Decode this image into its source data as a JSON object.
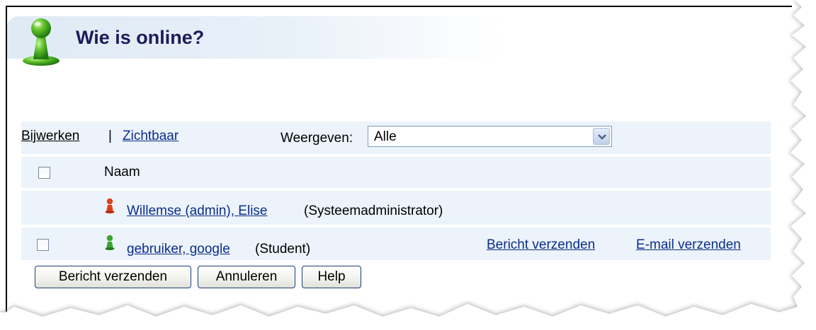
{
  "header": {
    "title": "Wie is online?"
  },
  "toolbar": {
    "refresh_label": "Bijwerken",
    "separator": "|",
    "visible_label": "Zichtbaar",
    "display_label": "Weergeven:",
    "display_selected": "Alle"
  },
  "table": {
    "column_name": "Naam",
    "rows": [
      {
        "name": "Willemse (admin), Elise",
        "role": "(Systeemadministrator)",
        "icon": "red-user-icon",
        "selectable": false
      },
      {
        "name": "gebruiker, google",
        "role": "(Student)",
        "icon": "green-user-icon",
        "selectable": true,
        "send_message_label": "Bericht verzenden",
        "send_email_label": "E-mail verzenden"
      }
    ]
  },
  "buttons": {
    "send_message": "Bericht verzenden",
    "cancel": "Annuleren",
    "help": "Help"
  },
  "colors": {
    "title": "#1c1c5a",
    "link": "#0a2d8c",
    "row_background": "#ecf3fa",
    "admin_icon": "#e0401a",
    "student_icon": "#3aa52a"
  }
}
